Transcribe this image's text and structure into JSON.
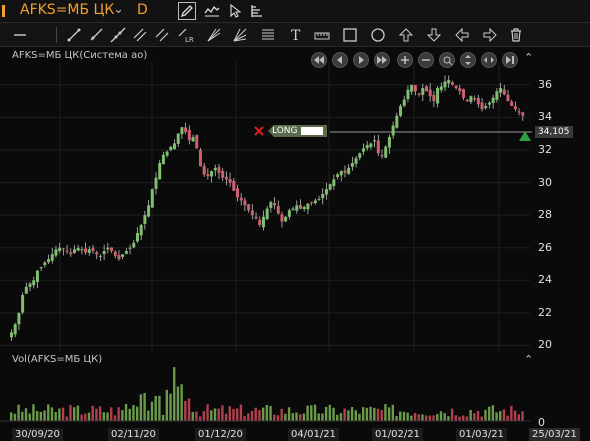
{
  "toolbar": {
    "ticker": "AFKS=МБ ЦК",
    "period": "D"
  },
  "chart": {
    "title": "AFKS=МБ ЦК(Система ао)",
    "volume_title": "Vol(AFKS=МБ ЦК)",
    "price_label": "34,105",
    "order_label": "LONG",
    "colors": {
      "up": "#7fbf6f",
      "down": "#d06070",
      "grid": "#1e1e1e",
      "accent": "#f0a030"
    }
  },
  "y_axis": [
    "36",
    "34",
    "32",
    "30",
    "28",
    "26",
    "24",
    "22",
    "20"
  ],
  "volume_axis": "0",
  "dates": [
    "30/09/20",
    "02/11/20",
    "01/12/20",
    "04/01/21",
    "01/02/21",
    "01/03/21",
    "25/03/21"
  ],
  "chart_data": {
    "type": "candlestick",
    "title": "AFKS=МБ ЦК(Система ао)",
    "ylim": [
      19.6,
      37.4
    ],
    "categories": [
      "30/09/20",
      "02/11/20",
      "01/12/20",
      "04/01/21",
      "01/02/21",
      "01/03/21",
      "25/03/21"
    ],
    "closes": [
      20.8,
      21.3,
      22.0,
      23.1,
      23.6,
      23.8,
      24.0,
      24.6,
      24.8,
      25.1,
      25.3,
      25.6,
      25.9,
      26.0,
      25.9,
      25.8,
      25.6,
      25.9,
      26.0,
      25.9,
      25.7,
      25.9,
      25.8,
      25.6,
      25.5,
      25.8,
      26.0,
      25.8,
      25.5,
      25.3,
      25.6,
      25.8,
      26.0,
      26.3,
      26.9,
      27.4,
      28.0,
      28.6,
      29.6,
      30.3,
      31.2,
      31.7,
      31.9,
      32.2,
      32.4,
      33.0,
      33.4,
      33.1,
      32.6,
      32.8,
      32.1,
      31.0,
      30.5,
      30.4,
      30.7,
      30.9,
      30.6,
      30.3,
      30.2,
      30.0,
      29.5,
      29.1,
      28.9,
      28.6,
      28.3,
      28.0,
      27.8,
      27.4,
      27.9,
      28.4,
      28.8,
      28.6,
      28.1,
      27.6,
      27.9,
      28.3,
      28.4,
      28.6,
      28.4,
      28.5,
      28.7,
      28.8,
      28.9,
      29.0,
      29.3,
      29.6,
      29.9,
      30.2,
      30.5,
      30.7,
      30.6,
      30.9,
      31.2,
      31.5,
      31.8,
      32.1,
      32.3,
      32.4,
      32.6,
      31.8,
      31.6,
      32.2,
      32.8,
      33.5,
      34.1,
      34.7,
      35.1,
      35.7,
      36.0,
      35.6,
      35.4,
      35.8,
      35.6,
      35.3,
      35.0,
      35.8,
      35.9,
      36.2,
      36.3,
      36.0,
      35.8,
      35.6,
      35.2,
      35.0,
      35.3,
      35.1,
      34.8,
      34.5,
      34.7,
      34.9,
      35.2,
      35.6,
      35.8,
      35.4,
      35.0,
      34.7,
      34.5,
      34.3,
      34.1
    ],
    "volume_max": 13
  }
}
